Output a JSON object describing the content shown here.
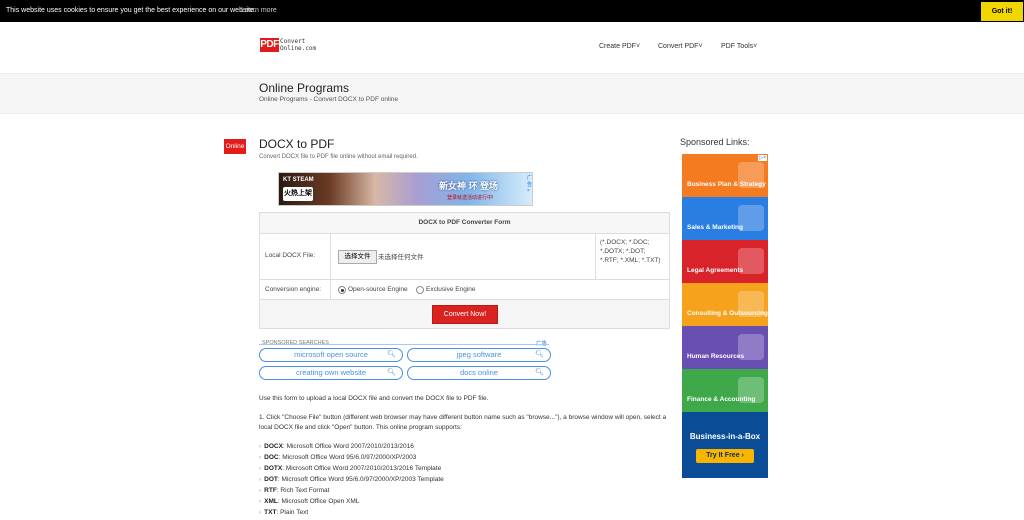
{
  "cookie": {
    "message": "This website uses cookies to ensure you get the best experience on our website.",
    "learn_more": "Learn more",
    "got_it": "Got it!"
  },
  "header": {
    "logo_mark": "PDF",
    "logo_line1": "Convert",
    "logo_line2": "Online.com",
    "nav": [
      {
        "label": "Create PDF˅"
      },
      {
        "label": "Convert PDF˅"
      },
      {
        "label": "PDF Tools˅"
      }
    ]
  },
  "banner": {
    "heading": "Online Programs",
    "breadcrumb": "Online Programs - Convert DOCX to PDF online"
  },
  "main": {
    "badge": "Online",
    "title": "DOCX to PDF",
    "subtitle": "Convert DOCX file to PDF file online without email required.",
    "ad": {
      "brand": "KT STEAM",
      "badge": "火热上架",
      "headline": "新女神 环 登场",
      "sub": "登录就送活动进行中!",
      "adchoice": "广告×"
    },
    "form": {
      "header": "DOCX to PDF Converter Form",
      "local_file_label": "Local DOCX File:",
      "choose_file": "选择文件",
      "no_file": "未选择任何文件",
      "accepted_types": "(*.DOCX; *.DOC; *.DOTX; *.DOT; *.RTF; *.XML; *.TXT)",
      "engine_label": "Conversion engine:",
      "engine_options": [
        "Open-source Engine",
        "Exclusive Engine"
      ],
      "engine_selected": "Open-source Engine",
      "convert_button": "Convert Now!"
    },
    "sponsored_searches": {
      "label": "SPONSORED SEARCHES",
      "ad_mark": "广告",
      "items": [
        "microsoft open source",
        "jpeg software",
        "creating own website",
        "docs online"
      ]
    },
    "para1": "Use this form to upload a local DOCX file and convert the DOCX file to PDF file.",
    "para2": "1. Click \"Choose File\" button (different web browser may have different button name such as \"browse...\"), a browse window will open, select a local DOCX file and click \"Open\" button. This online program supports:",
    "formats": [
      {
        "ext": "DOCX",
        "desc": ": Microsoft Office Word 2007/2010/2013/2016"
      },
      {
        "ext": "DOC",
        "desc": ": Microsoft Office Word 95/6.0/97/2000/XP/2003"
      },
      {
        "ext": "DOTX",
        "desc": ": Microsoft Office Word 2007/2010/2013/2016 Template"
      },
      {
        "ext": "DOT",
        "desc": ": Microsoft Office Word 95/6.0/97/2000/XP/2003 Template"
      },
      {
        "ext": "RTF",
        "desc": ": Rich Text Format"
      },
      {
        "ext": "XML",
        "desc": ": Microsoft Office Open XML"
      },
      {
        "ext": "TXT",
        "desc": ": Plain Text"
      }
    ]
  },
  "sidebar": {
    "title": "Sponsored Links:",
    "tiles": [
      {
        "label": "Business Plan & Strategy",
        "color": "#f47b20"
      },
      {
        "label": "Sales & Marketing",
        "color": "#2a7de1"
      },
      {
        "label": "Legal Agreements",
        "color": "#d8232a"
      },
      {
        "label": "Consulting & Outsourcing",
        "color": "#f6a21c"
      },
      {
        "label": "Human Resources",
        "color": "#6a4fb3"
      },
      {
        "label": "Finance & Accounting",
        "color": "#3fa84a"
      }
    ],
    "bab_title": "Business-in-a-Box",
    "bab_button": "Try It Free ›",
    "adchoice": "▷×"
  }
}
